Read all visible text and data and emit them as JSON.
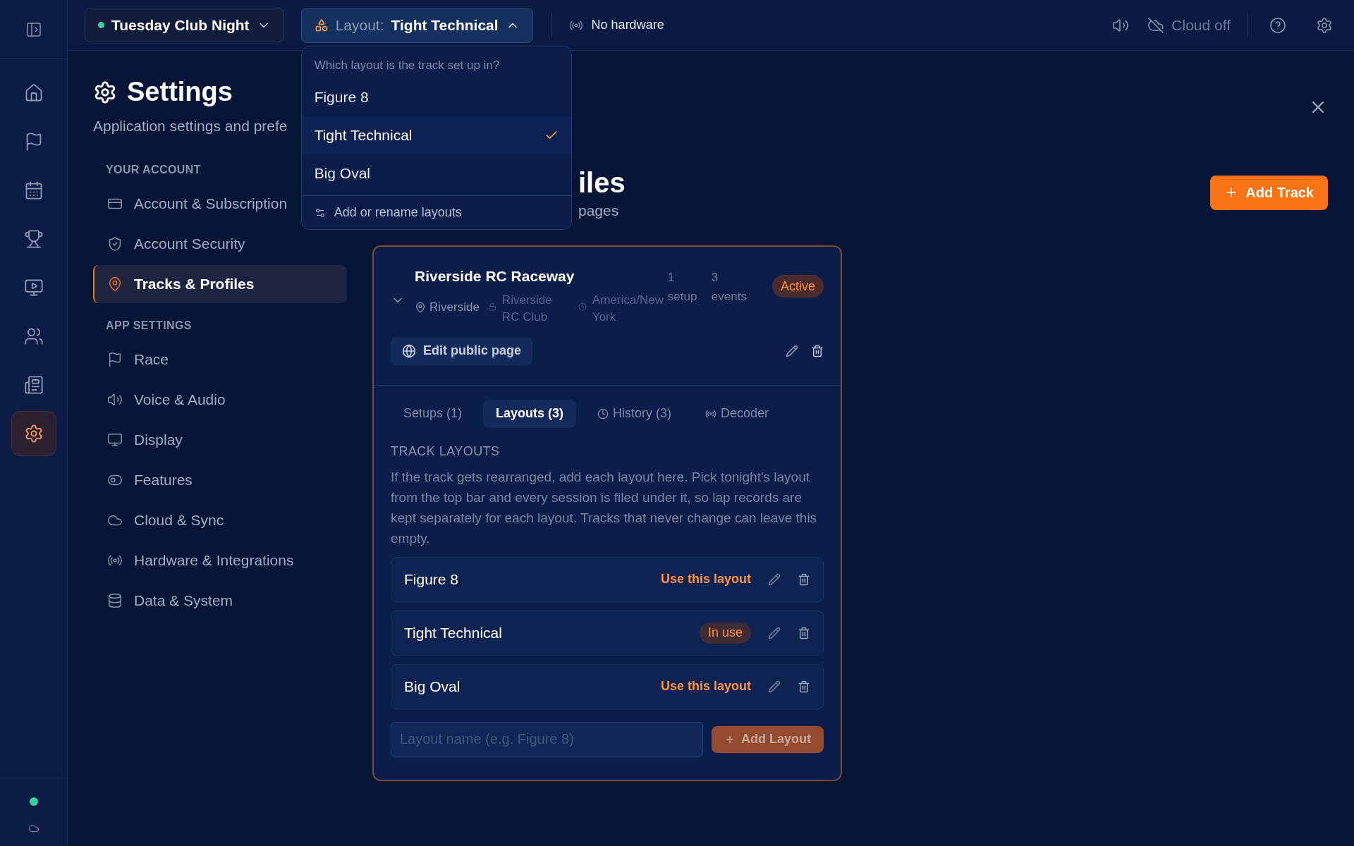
{
  "rail": {
    "items": [
      {
        "selected": false
      },
      {
        "selected": false
      },
      {
        "selected": false
      },
      {
        "selected": false
      },
      {
        "selected": false
      },
      {
        "selected": false
      },
      {
        "selected": false
      },
      {
        "selected": true
      }
    ],
    "connected": true
  },
  "top_bar": {
    "session": {
      "label": "Tuesday Club Night",
      "live": true
    },
    "layout": {
      "prefix": "Layout:",
      "value": "Tight Technical",
      "expanded": true
    },
    "hardware": "No hardware",
    "cloud": "Cloud off"
  },
  "layout_menu": {
    "prompt": "Which layout is the track set up in?",
    "options": [
      {
        "label": "Figure 8",
        "selected": false
      },
      {
        "label": "Tight Technical",
        "selected": true
      },
      {
        "label": "Big Oval",
        "selected": false
      }
    ],
    "manage": "Add or rename layouts"
  },
  "settings": {
    "title": "Settings",
    "subtitle": "Application settings and prefe"
  },
  "nav": {
    "sections": [
      {
        "heading": "YOUR ACCOUNT",
        "items": [
          {
            "label": "Account & Subscription",
            "selected": false
          },
          {
            "label": "Account Security",
            "selected": false
          },
          {
            "label": "Tracks & Profiles",
            "selected": true
          }
        ]
      },
      {
        "heading": "APP SETTINGS",
        "items": [
          {
            "label": "Race",
            "selected": false
          },
          {
            "label": "Voice & Audio",
            "selected": false
          },
          {
            "label": "Display",
            "selected": false
          },
          {
            "label": "Features",
            "selected": false
          },
          {
            "label": "Cloud & Sync",
            "selected": false
          },
          {
            "label": "Hardware & Integrations",
            "selected": false
          },
          {
            "label": "Data & System",
            "selected": false
          }
        ]
      }
    ]
  },
  "page": {
    "title": "iles",
    "subtitle": "pages",
    "add_button": "Add Track"
  },
  "track": {
    "name": "Riverside RC Raceway",
    "expanded": true,
    "city": "Riverside",
    "club": "Riverside RC Club",
    "timezone": "America/New York",
    "setups": "1 setup",
    "events": "3 events",
    "status": "Active",
    "edit_button": "Edit public page",
    "tabs": [
      {
        "label": "Setups (1)",
        "selected": false
      },
      {
        "label": "Layouts (3)",
        "selected": true
      },
      {
        "label": "History (3)",
        "selected": false
      },
      {
        "label": "Decoder",
        "selected": false
      }
    ],
    "section_heading": "TRACK LAYOUTS",
    "description": "If the track gets rearranged, add each layout here. Pick tonight's layout from the top bar and every session is filed under it, so lap records are kept separately for each layout. Tracks that never change can leave this empty.",
    "layouts": [
      {
        "name": "Figure 8",
        "in_use": false,
        "action": "Use this layout"
      },
      {
        "name": "Tight Technical",
        "in_use": true,
        "action": "In use"
      },
      {
        "name": "Big Oval",
        "in_use": false,
        "action": "Use this layout"
      }
    ],
    "new_layout": {
      "placeholder": "Layout name (e.g. Figure 8)"
    },
    "add_layout": {
      "label": "Add Layout",
      "disabled": true
    }
  }
}
